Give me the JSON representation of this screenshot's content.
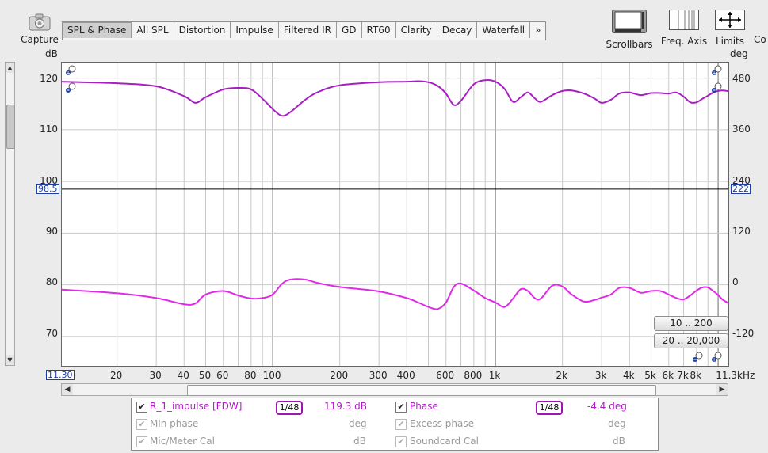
{
  "toolbar": {
    "capture_label": "Capture",
    "tabs": [
      "SPL & Phase",
      "All SPL",
      "Distortion",
      "Impulse",
      "Filtered IR",
      "GD",
      "RT60",
      "Clarity",
      "Decay",
      "Waterfall",
      "»"
    ],
    "active_tab": "SPL & Phase",
    "scrollbars_label": "Scrollbars",
    "freq_axis_label": "Freq. Axis",
    "limits_label": "Limits",
    "controls_label": "Co"
  },
  "axes": {
    "left_unit": "dB",
    "right_unit": "deg",
    "left_ticks": [
      "120",
      "110",
      "100",
      "90",
      "80",
      "70"
    ],
    "right_ticks": [
      "480",
      "360",
      "240",
      "120",
      "0",
      "-120"
    ],
    "cursor_left_value": "98.5",
    "cursor_right_value": "222",
    "x_ticks": [
      "20",
      "30",
      "40",
      "50",
      "60",
      "80",
      "100",
      "200",
      "300",
      "400",
      "600",
      "800",
      "1k",
      "2k",
      "3k",
      "4k",
      "5k",
      "6k",
      "7k",
      "8k",
      "11.3kHz"
    ],
    "x_start_value": "11.30"
  },
  "range_buttons": {
    "low": "10 .. 200",
    "full": "20 .. 20,000"
  },
  "colors": {
    "spl_trace": "#a61fc0",
    "phase_trace": "#e02ae8",
    "cursor_label": "#1f3fa8",
    "plot_bg": "#ffffff"
  },
  "legend": {
    "row1_left": {
      "checked": true,
      "name": "R_1_impulse [FDW]",
      "smoothing": "1/48",
      "value": "119.3 dB"
    },
    "row1_right": {
      "checked": true,
      "name": "Phase",
      "smoothing": "1/48",
      "value": "-4.4 deg"
    },
    "row2_left": {
      "checked": true,
      "name": "Min phase",
      "value": "deg"
    },
    "row2_right": {
      "checked": true,
      "name": "Excess phase",
      "value": "deg"
    },
    "row3_left": {
      "checked": true,
      "name": "Mic/Meter Cal",
      "value": "dB"
    },
    "row3_right": {
      "checked": true,
      "name": "Soundcard Cal",
      "value": "dB"
    }
  },
  "chart_data": {
    "type": "line",
    "x_scale": "log",
    "xlim": [
      11.3,
      11300
    ],
    "ylim_left": [
      64,
      123
    ],
    "ylim_right": [
      -177,
      513
    ],
    "ylabel": "dB",
    "ylabel_right": "deg",
    "series": [
      {
        "name": "R_1_impulse [FDW]",
        "axis": "left",
        "x": [
          11.3,
          20,
          30,
          40,
          45,
          50,
          60,
          70,
          80,
          90,
          100,
          110,
          120,
          140,
          160,
          200,
          300,
          400,
          450,
          500,
          550,
          600,
          650,
          700,
          800,
          900,
          1000,
          1100,
          1200,
          1300,
          1400,
          1500,
          1600,
          1800,
          2000,
          2200,
          2500,
          2800,
          3000,
          3300,
          3600,
          4000,
          4500,
          5000,
          5500,
          6000,
          6500,
          7000,
          7500,
          8000,
          8500,
          9000,
          9500,
          10000,
          10500,
          11300
        ],
        "y": [
          119.3,
          119.0,
          118.4,
          116.5,
          115.2,
          116.3,
          117.8,
          118.1,
          117.8,
          116.0,
          114.0,
          112.7,
          113.4,
          115.8,
          117.3,
          118.6,
          119.2,
          119.3,
          119.4,
          119.2,
          118.5,
          117.0,
          114.8,
          115.6,
          118.8,
          119.6,
          119.3,
          117.9,
          115.4,
          116.3,
          117.2,
          116.1,
          115.4,
          116.7,
          117.5,
          117.6,
          117.0,
          116.0,
          115.2,
          115.8,
          117.0,
          117.2,
          116.7,
          117.1,
          117.1,
          117.0,
          117.2,
          116.4,
          115.3,
          115.3,
          116.0,
          116.6,
          117.2,
          117.5,
          117.6,
          117.4
        ]
      },
      {
        "name": "Phase",
        "axis": "right",
        "x": [
          11.3,
          20,
          30,
          40,
          45,
          50,
          60,
          70,
          80,
          90,
          100,
          110,
          120,
          140,
          160,
          200,
          300,
          400,
          450,
          500,
          550,
          600,
          650,
          700,
          800,
          900,
          1000,
          1100,
          1200,
          1300,
          1400,
          1500,
          1600,
          1800,
          2000,
          2200,
          2500,
          2800,
          3000,
          3300,
          3600,
          4000,
          4500,
          5000,
          5500,
          6000,
          6500,
          7000,
          7500,
          8000,
          8500,
          9000,
          9500,
          10000,
          10500,
          11300
        ],
        "y": [
          -1,
          -9,
          -20,
          -34,
          -32,
          -12,
          -4,
          -14,
          -21,
          -20,
          -12,
          12,
          22,
          22,
          14,
          5,
          -5,
          -20,
          -30,
          -40,
          -45,
          -30,
          5,
          13,
          -3,
          -20,
          -30,
          -40,
          -21,
          0,
          -4,
          -20,
          -21,
          8,
          6,
          -12,
          -28,
          -24,
          -19,
          -12,
          3,
          3,
          -8,
          -4,
          -4,
          -12,
          -20,
          -23,
          -14,
          -3,
          4,
          4,
          -4,
          -13,
          -24,
          -33
        ]
      }
    ]
  }
}
